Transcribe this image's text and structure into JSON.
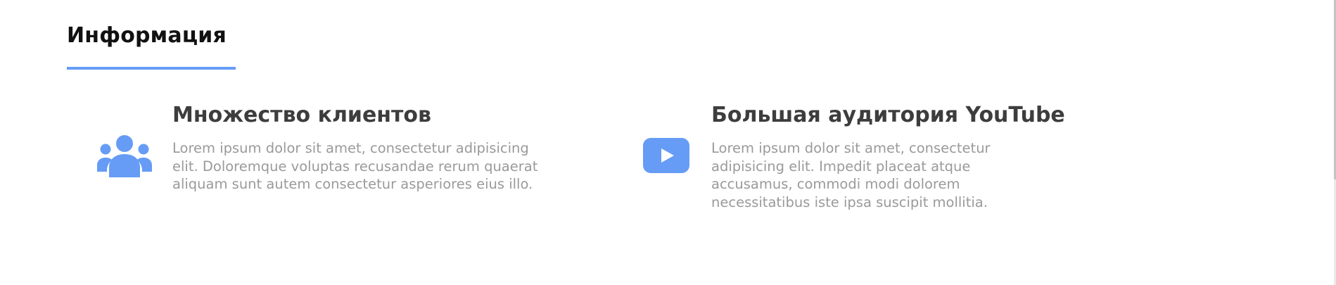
{
  "section": {
    "title": "Информация"
  },
  "features": [
    {
      "icon": "users-icon",
      "heading": "Множество клиентов",
      "text": "Lorem ipsum dolor sit amet, consectetur adipisicing elit. Doloremque voluptas recusandae rerum quaerat aliquam sunt autem consectetur asperiores eius illo."
    },
    {
      "icon": "youtube-play-icon",
      "heading": "Большая аудитория YouTube",
      "text": "Lorem ipsum dolor sit amet, consectetur adipisicing elit. Impedit placeat atque accusamus, commodi modi dolorem necessitatibus iste ipsa suscipit mollitia."
    }
  ],
  "colors": {
    "accent": "#669cf6",
    "heading": "#3d3d3d",
    "body_text": "#9a9a9a"
  }
}
